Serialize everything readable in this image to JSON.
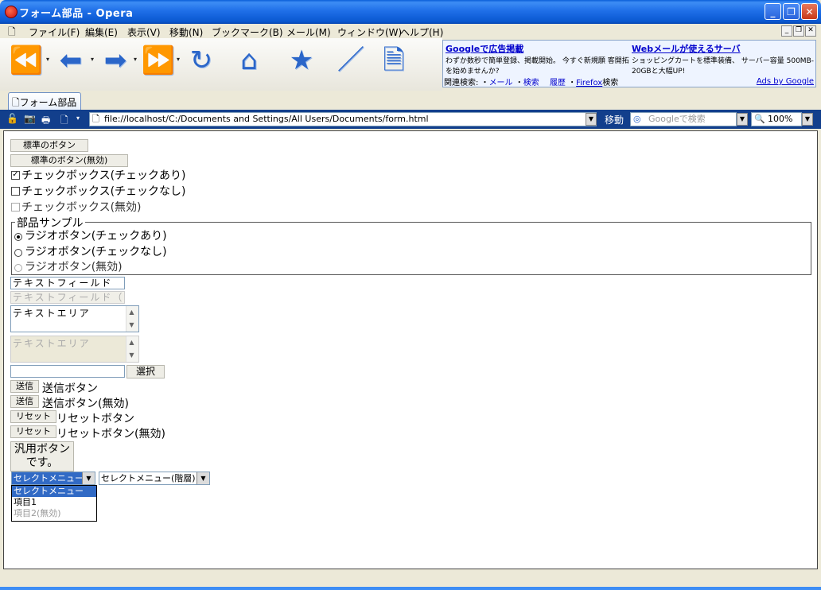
{
  "window": {
    "title": "フォーム部品 - Opera",
    "controls": [
      "_",
      "❐",
      "✕"
    ]
  },
  "menu": {
    "items": [
      "ファイル(F)",
      "編集(E)",
      "表示(V)",
      "移動(N)",
      "ブックマーク(B)",
      "メール(M)",
      "ウィンドウ(W)",
      "ヘルプ(H)"
    ],
    "mdi": [
      "_",
      "❐",
      "✕"
    ]
  },
  "ad": {
    "col1_title": "Googleで広告掲載",
    "col1_text": "わずか数秒で簡単登録、掲載開始。 今すぐ新規願 客開拓を始めませんか?",
    "col2_title": "Webメールが使えるサーバ",
    "col2_text": "ショッピングカートを標準装備、 サーバー容量 500MB-20GBと大幅UP!",
    "related_label": "関連検索:",
    "related_links": [
      "メール",
      "検索",
      "履歴",
      "Firefox"
    ],
    "related_suffix": [
      "",
      "",
      "",
      "検索"
    ],
    "ads_by": "Ads by Google"
  },
  "tab": {
    "label": "フォーム部品"
  },
  "addressbar": {
    "url": "file://localhost/C:/Documents and Settings/All Users/Documents/form.html",
    "go_label": "移動",
    "search_placeholder": "Googleで検索",
    "zoom": "100%"
  },
  "form": {
    "btn_std": "標準のボタン",
    "btn_std_disabled": "標準のボタン(無効)",
    "chk_checked": "チェックボックス(チェックあり)",
    "chk_unchecked": "チェックボックス(チェックなし)",
    "chk_disabled": "チェックボックス(無効)",
    "legend": "部品サンプル",
    "radio_checked": "ラジオボタン(チェックあり)",
    "radio_unchecked": "ラジオボタン(チェックなし)",
    "radio_disabled": "ラジオボタン(無効)",
    "text_field": "テキストフィールド",
    "text_field_disabled": "テキストフィールド（",
    "text_area": "テキストエリア",
    "text_area_disabled": "テキストエリア",
    "file_button": "選択",
    "submit_btn": "送信",
    "submit_label": "送信ボタン",
    "submit_btn_disabled": "送信",
    "submit_label_disabled": "送信ボタン(無効)",
    "reset_btn": "リセット",
    "reset_label": "リセットボタン",
    "reset_btn_disabled": "リセット",
    "reset_label_disabled": "リセットボタン(無効)",
    "generic_btn_line1": "汎用ボタン",
    "generic_btn_line2": "です。",
    "select1": "セレクトメニュー",
    "select2": "セレクトメニュー(階層)",
    "options": [
      "セレクトメニュー",
      "項目1",
      "項目2(無効)"
    ]
  },
  "colors": {
    "titlebar": "#0a58d0",
    "address_bg": "#123f8c",
    "select_highlight": "#316ac5"
  }
}
